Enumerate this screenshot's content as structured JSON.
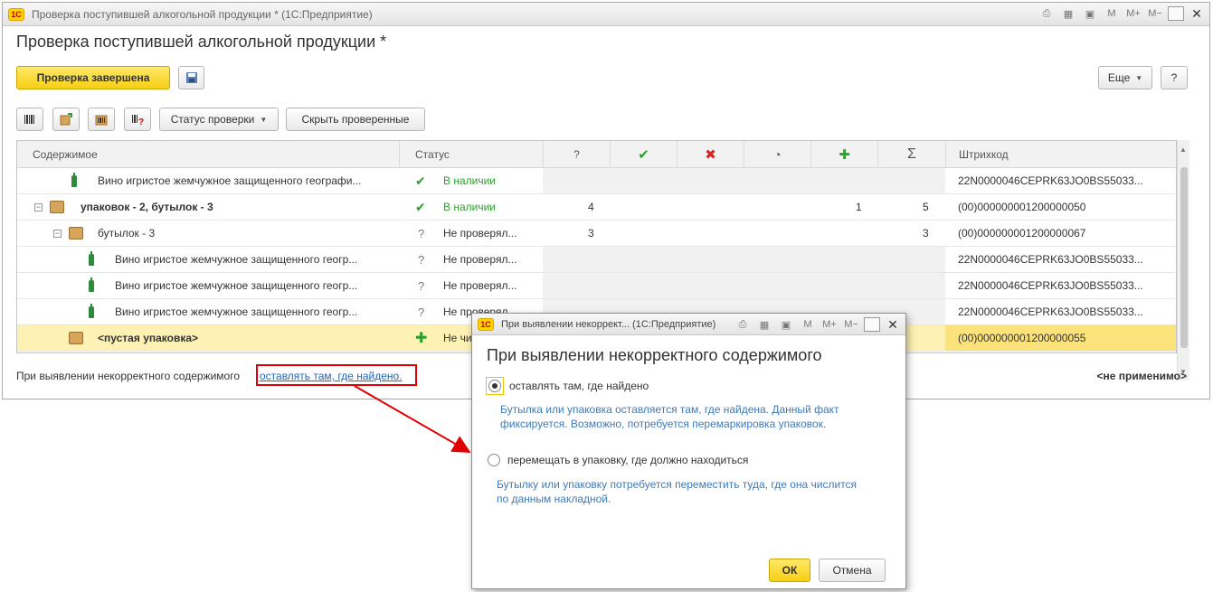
{
  "window": {
    "title": "Проверка поступившей алкогольной продукции *  (1С:Предприятие)",
    "logo": "1С",
    "form_title": "Проверка поступившей алкогольной продукции *"
  },
  "toolbar": {
    "finish_label": "Проверка завершена",
    "more_label": "Еще",
    "help_label": "?",
    "status_label": "Статус проверки",
    "hide_label": "Скрыть проверенные"
  },
  "table": {
    "columns": [
      "Содержимое",
      "Статус",
      "?",
      "✔",
      "✖",
      "◔",
      "✚",
      "Σ",
      "Штрихкод"
    ],
    "rows": [
      {
        "content": "Вино игристое жемчужное защищенного географи...",
        "status": "В наличии",
        "q": "",
        "ok": "",
        "sum": "",
        "plus": "",
        "barcode": "22N0000046CEPRK63JO0BS55033..."
      },
      {
        "content": "упаковок - 2, бутылок - 3",
        "status": "В наличии",
        "q": "4",
        "plus": "1",
        "sum": "5",
        "barcode": "(00)000000001200000050"
      },
      {
        "content": "бутылок - 3",
        "status": "Не проверял...",
        "q": "3",
        "plus": "",
        "sum": "3",
        "barcode": "(00)000000001200000067"
      },
      {
        "content": "Вино игристое жемчужное защищенного геогр...",
        "status": "Не проверял...",
        "barcode": "22N0000046CEPRK63JO0BS55033..."
      },
      {
        "content": "Вино игристое жемчужное защищенного геогр...",
        "status": "Не проверял...",
        "barcode": "22N0000046CEPRK63JO0BS55033..."
      },
      {
        "content": "Вино игристое жемчужное защищенного геогр...",
        "status": "Не проверял...",
        "barcode": "22N0000046CEPRK63JO0BS55033..."
      },
      {
        "content": "<пустая упаковка>",
        "status": "Не чи",
        "barcode": "(00)000000001200000055"
      }
    ]
  },
  "footer": {
    "text": "При выявлении некорректного содержимого",
    "link": "оставлять там, где найдено.",
    "na": "<не применимо>"
  },
  "dialog": {
    "title": "При выявлении некоррект...  (1С:Предприятие)",
    "heading": "При выявлении некорректного содержимого",
    "option1": "оставлять там, где найдено",
    "hint1_line1": "Бутылка или упаковка оставляется там, где найдена. Данный факт",
    "hint1_line2": "фиксируется. Возможно, потребуется перемаркировка упаковок.",
    "option2": "перемещать в упаковку, где должно находиться",
    "hint2_line1": "Бутылку или упаковку потребуется переместить туда, где она числится",
    "hint2_line2": "по данным накладной.",
    "ok": "ОК",
    "cancel": "Отмена",
    "toolbar_m": "M",
    "toolbar_mplus": "M+",
    "toolbar_mminus": "M−"
  },
  "colors": {
    "accent_yellow": "#f6cf13",
    "link_blue": "#2266bb",
    "highlight_red": "#e00000",
    "status_green": "#2e9e2e"
  }
}
